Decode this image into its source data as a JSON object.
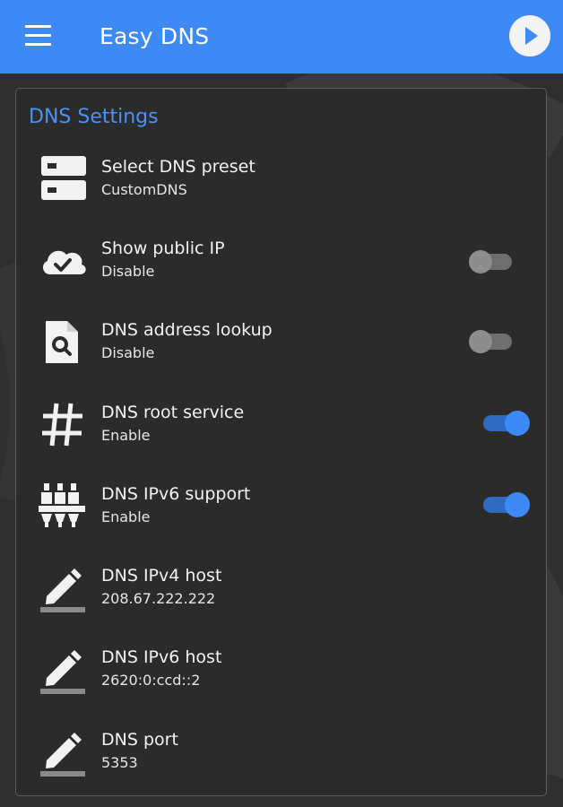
{
  "app": {
    "title": "Easy DNS",
    "accent_color": "#3d8af7",
    "menu_icon": "hamburger-menu-icon",
    "action_icon": "play-icon"
  },
  "settings": {
    "section_title": "DNS Settings",
    "items": [
      {
        "icon": "server-list-icon",
        "title": "Select DNS preset",
        "subtitle": "CustomDNS"
      },
      {
        "icon": "cloud-check-icon",
        "title": "Show public IP",
        "subtitle": "Disable",
        "toggle": false
      },
      {
        "icon": "file-search-icon",
        "title": "DNS address lookup",
        "subtitle": "Disable",
        "toggle": false
      },
      {
        "icon": "hash-icon",
        "title": "DNS root service",
        "subtitle": "Enable",
        "toggle": true
      },
      {
        "icon": "ethernet-ports-icon",
        "title": "DNS IPv6 support",
        "subtitle": "Enable",
        "toggle": true
      },
      {
        "icon": "edit-pencil-icon",
        "title": "DNS IPv4 host",
        "subtitle": "208.67.222.222"
      },
      {
        "icon": "edit-pencil-icon",
        "title": "DNS IPv6 host",
        "subtitle": "2620:0:ccd::2"
      },
      {
        "icon": "edit-pencil-icon",
        "title": "DNS port",
        "subtitle": "5353"
      }
    ]
  }
}
